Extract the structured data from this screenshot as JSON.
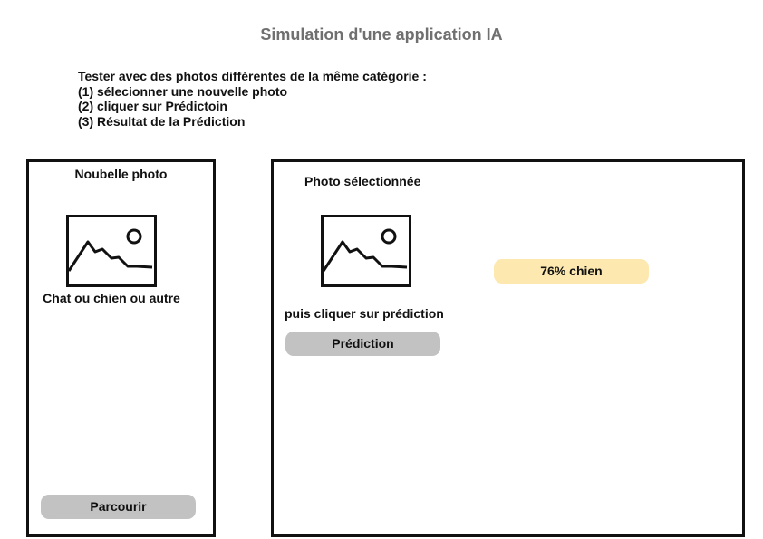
{
  "header": {
    "title": "Simulation d'une application IA"
  },
  "instructions": {
    "lines": [
      "Tester avec des photos différentes de la même catégorie :",
      "(1) sélecionner une nouvelle photo",
      "(2) cliquer sur Prédictoin",
      "(3) Résultat de la Prédiction"
    ]
  },
  "left_panel": {
    "title": "Noubelle photo",
    "image_icon": "image-placeholder-icon",
    "caption": "Chat ou chien ou autre",
    "browse_label": "Parcourir"
  },
  "right_panel": {
    "title": "Photo sélectionnée",
    "image_icon": "image-placeholder-icon",
    "hint": "puis cliquer sur prédiction",
    "predict_label": "Prédiction",
    "result": "76% chien"
  },
  "colors": {
    "title": "#707070",
    "button": "#c2c2c2",
    "result_badge": "#fde9b0",
    "border": "#111111"
  }
}
